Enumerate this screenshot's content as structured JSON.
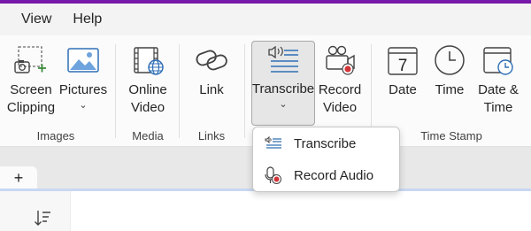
{
  "menu": {
    "items": [
      "View",
      "Help"
    ]
  },
  "ribbon": {
    "buttons": {
      "screen_clipping": [
        "Screen",
        "Clipping"
      ],
      "pictures": "Pictures",
      "online_video": [
        "Online",
        "Video"
      ],
      "link": "Link",
      "transcribe": "Transcribe",
      "record_video": [
        "Record",
        "Video"
      ],
      "date": "Date",
      "time": "Time",
      "date_time": [
        "Date &",
        "Time"
      ]
    },
    "date_icon_number": "7",
    "groups": {
      "images": "Images",
      "media": "Media",
      "links": "Links",
      "time_stamp": "Time Stamp"
    },
    "chevron": "⌄"
  },
  "dropdown": {
    "items": [
      {
        "label": "Transcribe",
        "icon": "transcribe-icon"
      },
      {
        "label": "Record Audio",
        "icon": "record-audio-icon"
      }
    ]
  },
  "tabs": {
    "add_label": "+"
  },
  "colors": {
    "accent": "#7719aa",
    "icon_blue": "#2f6fb5",
    "record_red": "#d13438"
  }
}
